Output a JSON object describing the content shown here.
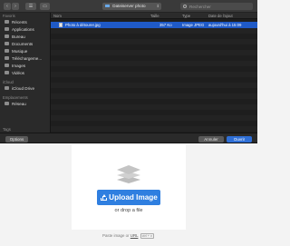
{
  "dialog": {
    "location": "Dateiserver photo",
    "search_placeholder": "Rechercher",
    "sidebar": {
      "favorites_header": "Favoris",
      "favorites": [
        "Récents",
        "Applications",
        "Bureau",
        "Documents",
        "Musique",
        "Téléchargeme...",
        "Images",
        "Vidéos"
      ],
      "icloud_header": "iCloud",
      "icloud_items": [
        "iCloud Drive"
      ],
      "locations_header": "Emplacements",
      "locations": [
        "Réseau"
      ],
      "tags_header": "Tags"
    },
    "columns": {
      "name": "Nom",
      "size": "Taille",
      "type": "Type",
      "date": "Date de l'ajout"
    },
    "file": {
      "name": "Photo à détourer.jpg",
      "size": "357 Ko",
      "type": "Image JPEG",
      "date": "aujourd'hui à 15:09"
    },
    "buttons": {
      "options": "Options",
      "cancel": "Annuler",
      "open": "Ouvrir"
    },
    "colors": {
      "selection": "#1f5ac7",
      "open_button": "#2f6fd6"
    }
  },
  "upload": {
    "button_label": "Upload Image",
    "drop_text": "or drop a file",
    "paste_prefix": "Paste image or",
    "paste_url": "URL",
    "paste_keys": "ctrl + v",
    "button_color": "#2f7fe0"
  }
}
